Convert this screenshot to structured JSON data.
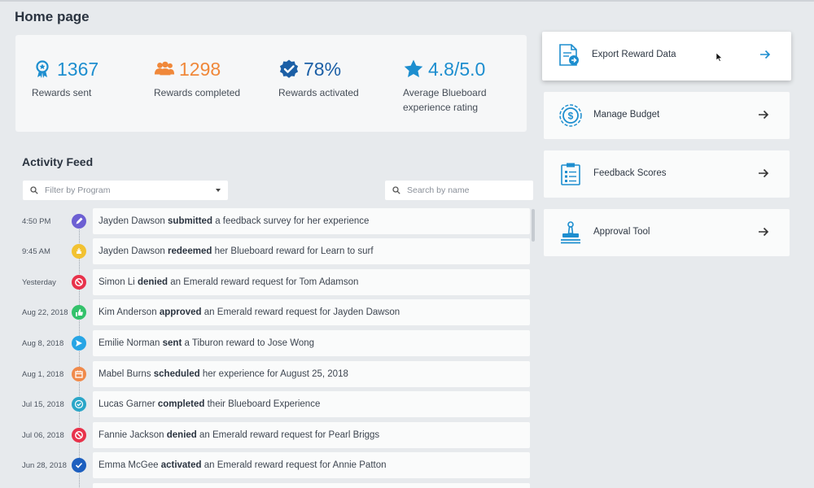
{
  "page": {
    "title": "Home page"
  },
  "stats": [
    {
      "value": "1367",
      "label": "Rewards sent",
      "icon": "ribbon-award-icon",
      "color": "#1d8ecf"
    },
    {
      "value": "1298",
      "label": "Rewards completed",
      "icon": "people-group-icon",
      "color": "#f0883a"
    },
    {
      "value": "78%",
      "label": "Rewards activated",
      "icon": "verified-badge-icon",
      "color": "#1b5fa6"
    },
    {
      "value": "4.8/5.0",
      "label": "Average Blueboard experience rating",
      "icon": "star-icon",
      "color": "#1d8ecf"
    }
  ],
  "feed": {
    "title": "Activity Feed",
    "filter_placeholder": "Filter by Program",
    "search_placeholder": "Search by name",
    "items": [
      {
        "time": "4:50 PM",
        "icon": "pencil-icon",
        "icon_color": "#6c5fd3",
        "before": "Jayden Dawson",
        "action": "submitted",
        "after": "a feedback survey for her experience"
      },
      {
        "time": "9:45 AM",
        "icon": "redeem-gift-icon",
        "icon_color": "#f2c232",
        "before": "Jayden Dawson",
        "action": "redeemed",
        "after": "her Blueboard reward for Learn to surf"
      },
      {
        "time": "Yesterday",
        "icon": "denied-icon",
        "icon_color": "#e8324b",
        "before": "Simon Li",
        "action": "denied",
        "after": "an Emerald reward request for Tom Adamson"
      },
      {
        "time": "Aug 22, 2018",
        "icon": "thumbs-up-icon",
        "icon_color": "#33c26b",
        "before": "Kim Anderson",
        "action": "approved",
        "after": "an Emerald reward request for Jayden Dawson"
      },
      {
        "time": "Aug 8, 2018",
        "icon": "send-icon",
        "icon_color": "#27a5e5",
        "before": "Emilie Norman",
        "action": "sent",
        "after": "a Tiburon reward to Jose Wong"
      },
      {
        "time": "Aug 1, 2018",
        "icon": "calendar-icon",
        "icon_color": "#f08a4b",
        "before": "Mabel Burns",
        "action": "scheduled",
        "after": "her experience for August 25, 2018"
      },
      {
        "time": "Jul 15, 2018",
        "icon": "check-badge-icon",
        "icon_color": "#2aa6c8",
        "before": "Lucas Garner",
        "action": "completed",
        "after": "their Blueboard Experience"
      },
      {
        "time": "Jul 06, 2018",
        "icon": "denied-icon",
        "icon_color": "#e8324b",
        "before": "Fannie Jackson",
        "action": "denied",
        "after": "an Emerald reward request for Pearl Briggs"
      },
      {
        "time": "Jun 28, 2018",
        "icon": "checkmark-icon",
        "icon_color": "#1d5fbf",
        "before": "Emma McGee",
        "action": "activated",
        "after": "an Emerald reward request for Annie Patton"
      }
    ]
  },
  "actions": [
    {
      "label": "Export Reward Data",
      "icon": "export-document-icon",
      "active": true
    },
    {
      "label": "Manage Budget",
      "icon": "dollar-coin-icon",
      "active": false
    },
    {
      "label": "Feedback Scores",
      "icon": "clipboard-checklist-icon",
      "active": false
    },
    {
      "label": "Approval Tool",
      "icon": "approval-stamp-icon",
      "active": false
    }
  ],
  "colors": {
    "accent": "#1d8ecf",
    "background": "#e7eaed",
    "card": "#f6f7f8"
  }
}
